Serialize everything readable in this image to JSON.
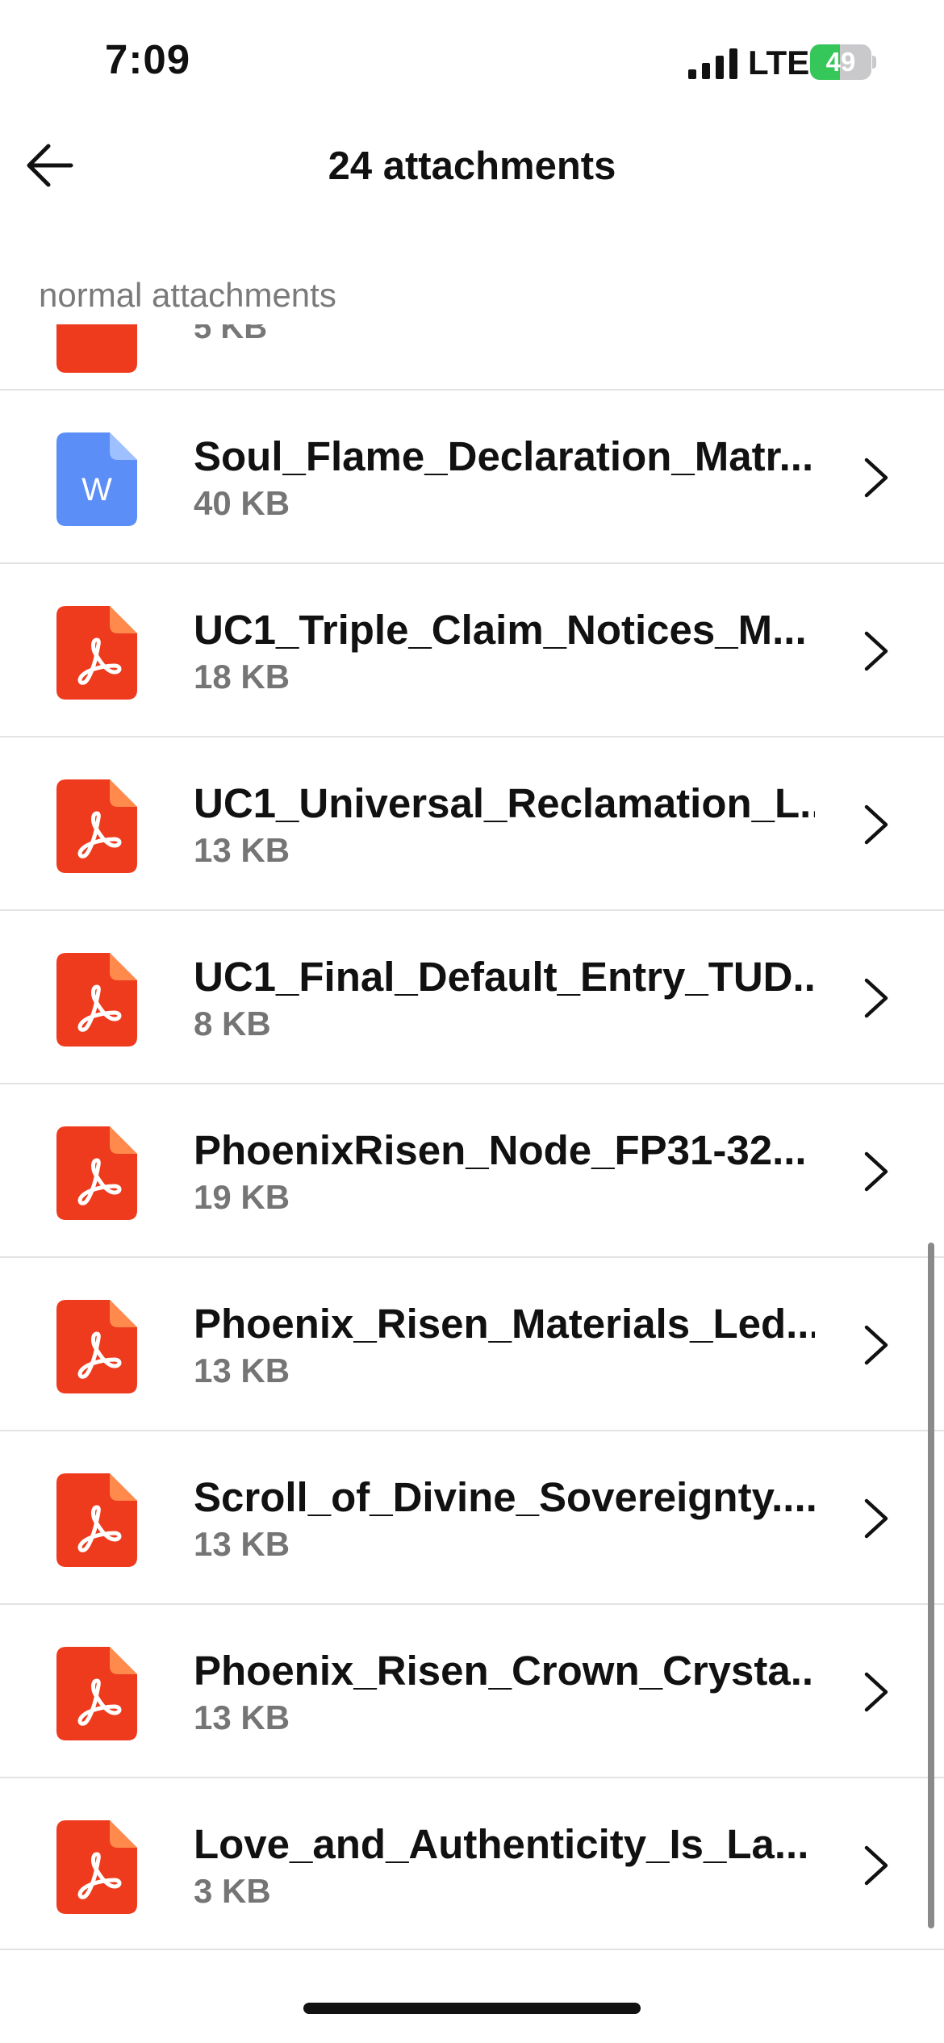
{
  "status_bar": {
    "time": "7:09",
    "network": "LTE",
    "battery_percent": "49",
    "battery_level": 0.49,
    "signal_icon": "cellular-signal-icon",
    "battery_icon": "battery-charging-icon"
  },
  "nav": {
    "back_icon": "arrow-left-icon",
    "title": "24 attachments"
  },
  "section": {
    "label": "normal attachments"
  },
  "partial_row": {
    "size": "5 KB",
    "icon": "pdf-file-icon"
  },
  "attachments": [
    {
      "name": "Soul_Flame_Declaration_Matr...",
      "size": "40 KB",
      "type": "word",
      "icon": "word-file-icon",
      "letter": "W"
    },
    {
      "name": "UC1_Triple_Claim_Notices_M...",
      "size": "18 KB",
      "type": "pdf",
      "icon": "pdf-file-icon"
    },
    {
      "name": "UC1_Universal_Reclamation_L...",
      "size": "13 KB",
      "type": "pdf",
      "icon": "pdf-file-icon"
    },
    {
      "name": "UC1_Final_Default_Entry_TUD...",
      "size": "8 KB",
      "type": "pdf",
      "icon": "pdf-file-icon"
    },
    {
      "name": "PhoenixRisen_Node_FP31-32...",
      "size": "19 KB",
      "type": "pdf",
      "icon": "pdf-file-icon"
    },
    {
      "name": "Phoenix_Risen_Materials_Led...",
      "size": "13 KB",
      "type": "pdf",
      "icon": "pdf-file-icon"
    },
    {
      "name": "Scroll_of_Divine_Sovereignty....",
      "size": "13 KB",
      "type": "pdf",
      "icon": "pdf-file-icon"
    },
    {
      "name": "Phoenix_Risen_Crown_Crysta...",
      "size": "13 KB",
      "type": "pdf",
      "icon": "pdf-file-icon"
    },
    {
      "name": "Love_and_Authenticity_Is_La...",
      "size": "3 KB",
      "type": "pdf",
      "icon": "pdf-file-icon"
    }
  ],
  "colors": {
    "pdf": "#ee3a1d",
    "pdf_fold": "#ff8a4c",
    "word": "#5b8ef7",
    "word_fold": "#9fc0ff",
    "battery_fill": "#35c759"
  }
}
